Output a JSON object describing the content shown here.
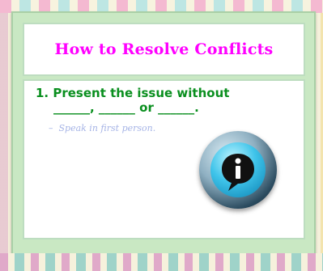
{
  "slide": {
    "title": "How to Resolve Conflicts",
    "bullet1_line1": "1. Present the issue without",
    "bullet1_line2": "______, ______ or ______.",
    "sub_bullet": "Speak in first person."
  },
  "colors": {
    "title": "#ff00ff",
    "bullet": "#0a8f1f",
    "sub_bullet": "#a6b4e6",
    "frame": "#c9e8c3"
  },
  "icons": {
    "info": "info-icon"
  }
}
